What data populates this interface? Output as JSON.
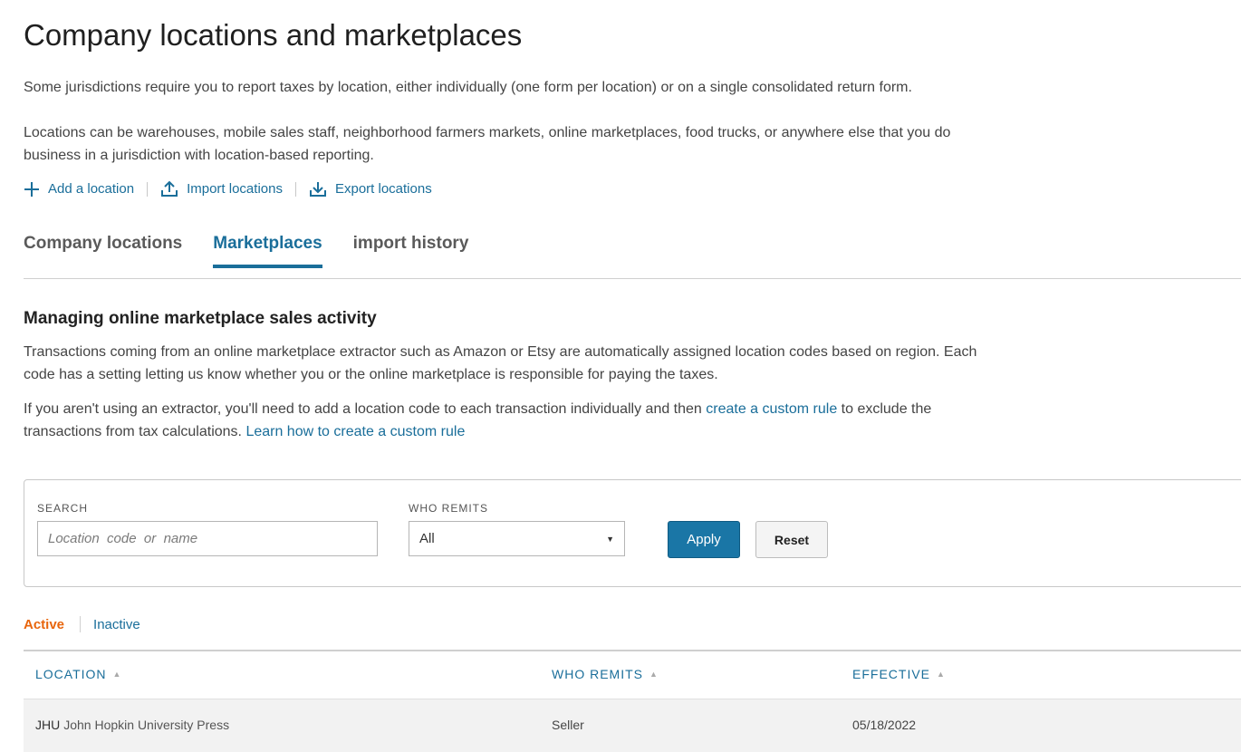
{
  "page": {
    "title": "Company locations and marketplaces",
    "intro_1": "Some jurisdictions require you to report taxes by location, either individually (one form per location) or on a single consolidated return form.",
    "intro_2": "Locations can be warehouses, mobile sales staff, neighborhood farmers markets, online marketplaces, food trucks, or anywhere else that you do business in a jurisdiction with location-based reporting."
  },
  "actions": {
    "add": {
      "label": "Add a location",
      "icon": "plus-icon"
    },
    "import": {
      "label": "Import locations",
      "icon": "upload-icon"
    },
    "export": {
      "label": "Export locations",
      "icon": "download-icon"
    }
  },
  "tabs": [
    {
      "label": "Company locations",
      "active": false
    },
    {
      "label": "Marketplaces",
      "active": true
    },
    {
      "label": "import history",
      "active": false
    }
  ],
  "section": {
    "title": "Managing online marketplace sales activity",
    "para1": "Transactions coming from an online marketplace extractor such as Amazon or Etsy are automatically assigned location codes based on region. Each code has a setting letting us know whether you or the online marketplace is responsible for paying the taxes.",
    "para2_start": "If you aren't using an extractor, you'll need to add a location code to each transaction individually and then ",
    "para2_link1": "create a custom rule",
    "para2_mid": " to exclude the transactions from tax calculations. ",
    "para2_link2": "Learn how to create a custom rule"
  },
  "filters": {
    "search_label": "SEARCH",
    "search_placeholder": "Location  code  or  name",
    "search_value": "",
    "remits_label": "WHO REMITS",
    "remits_value": "All",
    "apply_label": "Apply",
    "reset_label": "Reset"
  },
  "status_tabs": {
    "active": "Active",
    "inactive": "Inactive"
  },
  "table": {
    "columns": [
      "LOCATION",
      "WHO REMITS",
      "EFFECTIVE"
    ],
    "rows": [
      {
        "code": "JHU",
        "name": "John Hopkin University Press",
        "who_remits": "Seller",
        "effective": "05/18/2022"
      }
    ]
  },
  "colors": {
    "link": "#1a6e9a",
    "primary_button": "#1a76a6",
    "active_status": "#e8650c"
  }
}
